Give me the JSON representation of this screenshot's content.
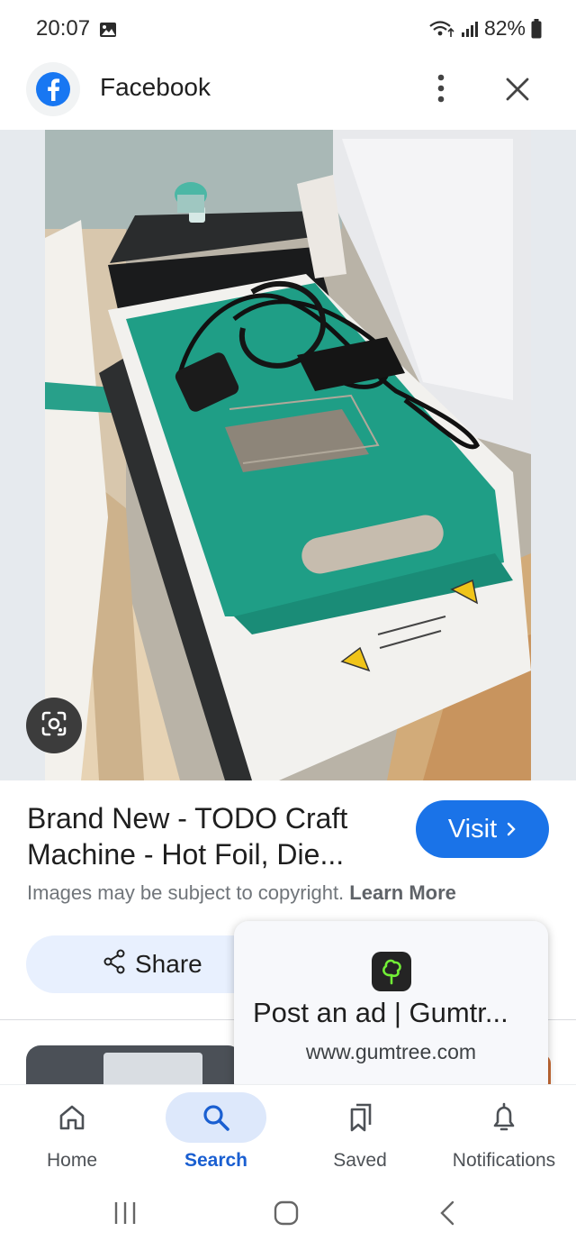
{
  "status_bar": {
    "time": "20:07",
    "battery": "82%",
    "icons": [
      "gallery-icon",
      "wifi-calling-icon",
      "signal-icon",
      "battery-icon"
    ]
  },
  "header": {
    "title": "Facebook",
    "logo_icon": "facebook-logo-icon",
    "actions": [
      "more-vert-icon",
      "close-icon"
    ]
  },
  "result": {
    "title": "Brand New - TODO Craft Machine - Hot Foil, Die...",
    "visit_label": "Visit",
    "copyright_text": "Images may be subject to copyright.",
    "learn_more_label": "Learn More",
    "share_label": "Share"
  },
  "popup": {
    "title": "Post an ad | Gumtr...",
    "url": "www.gumtree.com",
    "icon": "gumtree-tree-icon"
  },
  "bottom_nav": {
    "items": [
      {
        "label": "Home",
        "icon": "home-icon",
        "active": false
      },
      {
        "label": "Search",
        "icon": "search-icon",
        "active": true
      },
      {
        "label": "Saved",
        "icon": "bookmarks-icon",
        "active": false
      },
      {
        "label": "Notifications",
        "icon": "bell-icon",
        "active": false
      }
    ]
  },
  "system_nav": [
    "recent-apps-icon",
    "home-circle-icon",
    "back-icon"
  ],
  "colors": {
    "accent": "#1a73e8",
    "share_bg": "#e8f0fe",
    "active_nav": "#1a5fd1",
    "mat_teal": "#1f9e86"
  }
}
